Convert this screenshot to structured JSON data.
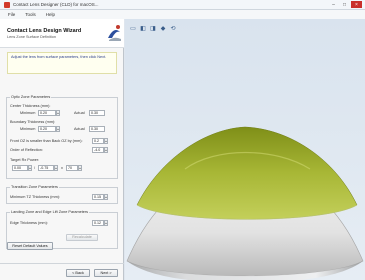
{
  "window": {
    "title": "Contact Lens Designer (CLD) for macOS...",
    "controls": [
      "–",
      "□",
      "×"
    ]
  },
  "menu": [
    "File",
    "Tools",
    "Help"
  ],
  "wizard": {
    "title": "Contact Lens Design Wizard",
    "subtitle": "Lens Zone Surface Definition",
    "info": "Adjust the lens from surface parameters, then click Next."
  },
  "optic_zone": {
    "group_title": "Optic Zone Parameters",
    "center_thickness": {
      "label": "Center Thickness (mm):",
      "min_label": "Minimum",
      "min_value": "0.20",
      "actual_label": "Actual",
      "actual_value": "0.30"
    },
    "boundary_thickness": {
      "label": "Boundary Thickness (mm):",
      "min_label": "Minimum",
      "min_value": "0.20",
      "actual_label": "Actual",
      "actual_value": "0.30"
    },
    "front_oz_diameter": {
      "label": "Front OZ is smaller than Back OZ by (mm):",
      "value": "0.2"
    },
    "order_of_reflection": {
      "label": "Order of Reflection:",
      "value": "-4.0"
    },
    "target_rx": {
      "label": "Target Rx Power:",
      "sphere": "0.00",
      "cylinder": "-0.75",
      "axis": "70",
      "sep1": "/",
      "sep2": "x"
    }
  },
  "transition_zone": {
    "group_title": "Transition Zone Parameters",
    "min_tz_thickness": {
      "label": "Minimum TZ Thickness (mm):",
      "value": "0.15"
    }
  },
  "landing_zone": {
    "group_title": "Landing Zone and Edge Lift Zone Parameters",
    "edge_thickness": {
      "label": "Edge Thickness (mm):",
      "value": "0.12"
    },
    "recalc_button": "Recalculate"
  },
  "buttons": {
    "reset": "Reset Default Values",
    "back": "< Back",
    "next": "Next >"
  },
  "viewport": {
    "toolbar_icons": [
      "view-front-icon",
      "view-side-icon",
      "view-top-icon",
      "view-iso-icon",
      "reset-view-icon"
    ],
    "colors": {
      "optic_zone": "#a8b736",
      "outer_zone": "#ececec",
      "background": "#dfe8f1"
    }
  }
}
